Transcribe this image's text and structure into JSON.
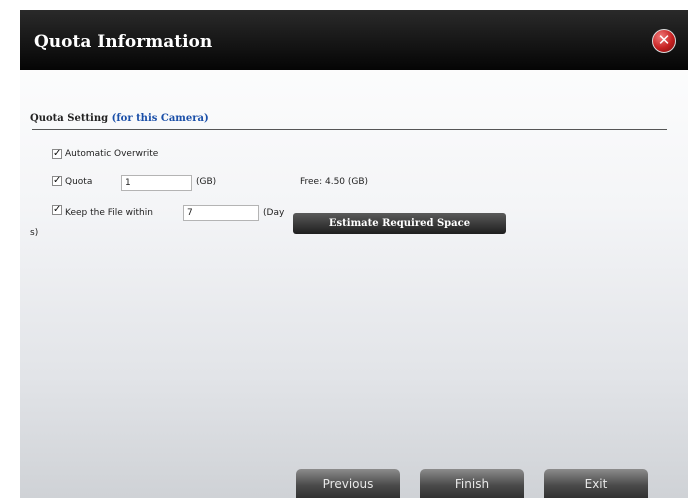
{
  "dialog": {
    "title": "Quota Information",
    "close_icon_glyph": "✕"
  },
  "section": {
    "heading": "Quota Setting",
    "subheading": "(for this Camera)"
  },
  "options": {
    "auto_overwrite": {
      "label": "Automatic Overwrite",
      "checked": true
    },
    "quota": {
      "label": "Quota",
      "value": "1",
      "unit": "(GB)",
      "checked": true
    },
    "free_space": "Free: 4.50 (GB)",
    "keep_file": {
      "label": "Keep the File within",
      "value": "7",
      "unit_part1": "(Day",
      "unit_part2": "s)",
      "checked": true
    },
    "estimate_button": "Estimate Required Space"
  },
  "footer": {
    "previous": "Previous",
    "finish": "Finish",
    "exit": "Exit"
  },
  "colors": {
    "title_bar": "#050505",
    "close_button": "#c62020",
    "subheading_link": "#1a4fa8"
  }
}
